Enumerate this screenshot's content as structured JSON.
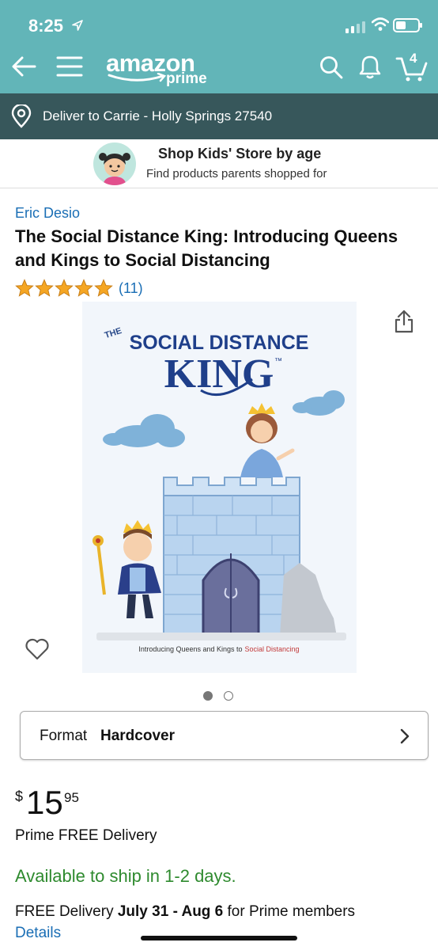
{
  "status_bar": {
    "time": "8:25"
  },
  "header": {
    "logo_word": "amazon",
    "logo_sub": "prime",
    "cart_count": "4"
  },
  "delivery": {
    "text": "Deliver to Carrie - Holly Springs 27540"
  },
  "kids_banner": {
    "title": "Shop Kids' Store by age",
    "subtitle": "Find products parents shopped for"
  },
  "product": {
    "author": "Eric Desio",
    "title": "The Social Distance King: Introducing Queens and Kings to Social Distancing",
    "rating_stars": 5,
    "rating_count": "(11)",
    "cover": {
      "line1": "THE",
      "line2": "SOCIAL DISTANCE",
      "line3": "KING",
      "tm": "™",
      "caption_a": "Introducing Queens and Kings to",
      "caption_b": "Social Distancing"
    },
    "image_count": 2,
    "image_index": 1
  },
  "format": {
    "label": "Format",
    "value": "Hardcover"
  },
  "price": {
    "currency": "$",
    "whole": "15",
    "fraction": "95"
  },
  "shipping": {
    "prime": "Prime FREE Delivery",
    "availability": "Available to ship in 1-2 days.",
    "free_prefix": "FREE Delivery",
    "free_dates": "July 31 - Aug 6",
    "free_suffix": "for Prime members",
    "details_link": "Details"
  },
  "colors": {
    "header_bg": "#62b5b8",
    "deliver_bg": "#37575b",
    "link": "#1a6eb5",
    "in_stock": "#2e8a2e",
    "star": "#f5a623"
  }
}
